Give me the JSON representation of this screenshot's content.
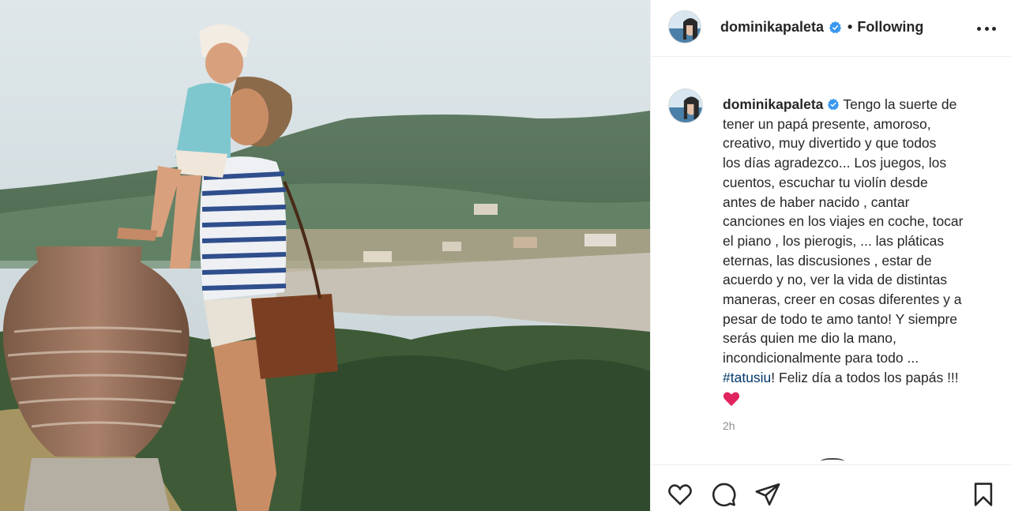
{
  "post": {
    "photo_alt": ""
  },
  "header": {
    "username": "dominikapaleta",
    "follow_state": "Following",
    "dot": "•"
  },
  "caption": {
    "username": "dominikapaleta",
    "lines": [
      "Tengo la suerte de",
      "tener un papá presente, amoroso,",
      "creativo, muy divertido y que todos",
      "los días agradezco... Los juegos, los",
      "cuentos, escuchar tu violín desde",
      "antes de haber nacido , cantar",
      "canciones en los viajes en coche, tocar",
      "el piano , los pierogis, ... las pláticas",
      "eternas, las discusiones , estar de",
      "acuerdo y no, ver la vida de distintas",
      "maneras, creer en cosas diferentes y a",
      "pesar de todo te amo tanto! Y siempre",
      "serás quien me dio la mano,",
      "incondicionalmente para todo ..."
    ],
    "hashtag": "#tatusiu",
    "after_hashtag": "! Feliz día a todos los papás !!!",
    "timestamp": "2h"
  },
  "icons": {
    "verified": "verified-badge-icon",
    "more": "more-options-icon",
    "like": "heart-outline-icon",
    "comment": "comment-bubble-icon",
    "share": "paper-plane-icon",
    "save": "bookmark-icon",
    "emoji": "red-heart-emoji-icon"
  },
  "colors": {
    "verified": "#3897f0",
    "hashtag": "#00376b",
    "text": "#262626",
    "muted": "#8e8e8e",
    "heart": "#ed4956",
    "divider": "#efefef"
  }
}
